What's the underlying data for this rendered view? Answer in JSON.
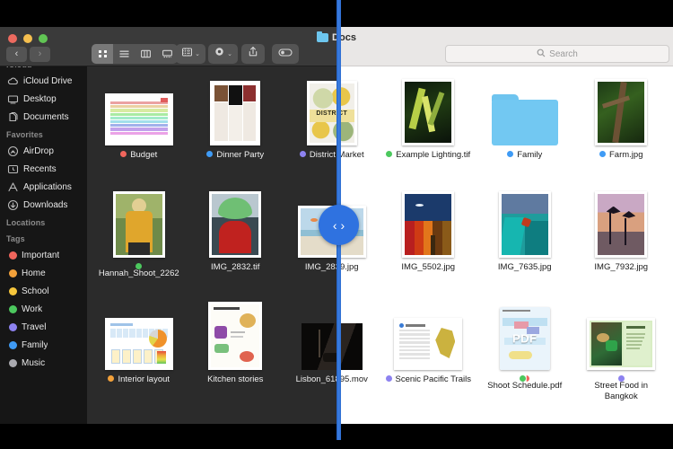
{
  "window": {
    "title": "Docs",
    "traffic_lights": [
      "close",
      "minimize",
      "zoom"
    ],
    "nav": {
      "back": "‹",
      "forward": "›"
    }
  },
  "toolbar": {
    "view_modes": [
      {
        "name": "icon-view",
        "glyph": "icon",
        "selected": true
      },
      {
        "name": "list-view",
        "glyph": "list",
        "selected": false
      },
      {
        "name": "column-view",
        "glyph": "column",
        "selected": false
      },
      {
        "name": "gallery-view",
        "glyph": "gallery",
        "selected": false
      }
    ],
    "group_by_label": "group-by",
    "action_label": "action",
    "share_label": "share",
    "tag_label": "tags",
    "chevron": "⌄"
  },
  "search": {
    "placeholder": "Search",
    "value": "",
    "icon": "search-icon"
  },
  "sidebar": {
    "sections": [
      {
        "title": "iCloud",
        "items": [
          {
            "label": "iCloud Drive",
            "icon": "cloud-icon"
          },
          {
            "label": "Desktop",
            "icon": "desktop-icon"
          },
          {
            "label": "Documents",
            "icon": "documents-icon"
          }
        ]
      },
      {
        "title": "Favorites",
        "items": [
          {
            "label": "AirDrop",
            "icon": "airdrop-icon"
          },
          {
            "label": "Recents",
            "icon": "recents-icon"
          },
          {
            "label": "Applications",
            "icon": "applications-icon"
          },
          {
            "label": "Downloads",
            "icon": "downloads-icon"
          }
        ]
      },
      {
        "title": "Locations",
        "items": []
      },
      {
        "title": "Tags",
        "items": [
          {
            "label": "Important",
            "icon": "tag-dot",
            "color": "#f0655c"
          },
          {
            "label": "Home",
            "icon": "tag-dot",
            "color": "#f3a13a"
          },
          {
            "label": "School",
            "icon": "tag-dot",
            "color": "#f6c63c"
          },
          {
            "label": "Work",
            "icon": "tag-dot",
            "color": "#4cc85e"
          },
          {
            "label": "Travel",
            "icon": "tag-dot",
            "color": "#8d82f0"
          },
          {
            "label": "Family",
            "icon": "tag-dot",
            "color": "#3f9bf5"
          },
          {
            "label": "Music",
            "icon": "tag-dot",
            "color": "#a9a9af"
          }
        ]
      }
    ]
  },
  "files": [
    {
      "name": "Budget",
      "kind": "spreadsheet",
      "tags": [
        "#f0655c"
      ]
    },
    {
      "name": "Dinner Party",
      "kind": "magazine",
      "tags": [
        "#3f9bf5"
      ]
    },
    {
      "name": "District Market",
      "kind": "poster",
      "tags": [
        "#8d82f0"
      ]
    },
    {
      "name": "Example Lighting.tif",
      "kind": "photo-plant",
      "tags": [
        "#4cc85e"
      ]
    },
    {
      "name": "Family",
      "kind": "folder",
      "tags": [
        "#3f9bf5"
      ]
    },
    {
      "name": "Farm.jpg",
      "kind": "photo-tree",
      "tags": [
        "#3f9bf5"
      ]
    },
    {
      "name": "Hannah_Shoot_2262",
      "kind": "photo-portrait",
      "tags": [
        "#4cc85e"
      ]
    },
    {
      "name": "IMG_2832.tif",
      "kind": "photo-hat",
      "tags": []
    },
    {
      "name": "IMG_2839.jpg",
      "kind": "photo-beach",
      "tags": []
    },
    {
      "name": "IMG_5502.jpg",
      "kind": "photo-colorwall",
      "tags": []
    },
    {
      "name": "IMG_7635.jpg",
      "kind": "photo-jump",
      "tags": []
    },
    {
      "name": "IMG_7932.jpg",
      "kind": "photo-palms",
      "tags": []
    },
    {
      "name": "Interior layout",
      "kind": "chartdoc",
      "tags": [
        "#f3a13a"
      ]
    },
    {
      "name": "Kitchen stories",
      "kind": "recipe",
      "tags": []
    },
    {
      "name": "Lisbon_61895.mov",
      "kind": "movie",
      "tags": []
    },
    {
      "name": "Scenic Pacific Trails",
      "kind": "maptable",
      "tags": [
        "#8d82f0"
      ]
    },
    {
      "name": "Shoot Schedule.pdf",
      "kind": "pdf",
      "tags": [
        "#4cc85e",
        "#f0655c"
      ],
      "pdf_label": "PDF"
    },
    {
      "name": "Street Food in Bangkok",
      "kind": "greendoc",
      "tags": [
        "#8d82f0"
      ]
    }
  ],
  "comparison_slider": {
    "left_arrow": "‹",
    "right_arrow": "›",
    "divider_color": "#2f72e0",
    "left_theme": "dark",
    "right_theme": "light"
  }
}
